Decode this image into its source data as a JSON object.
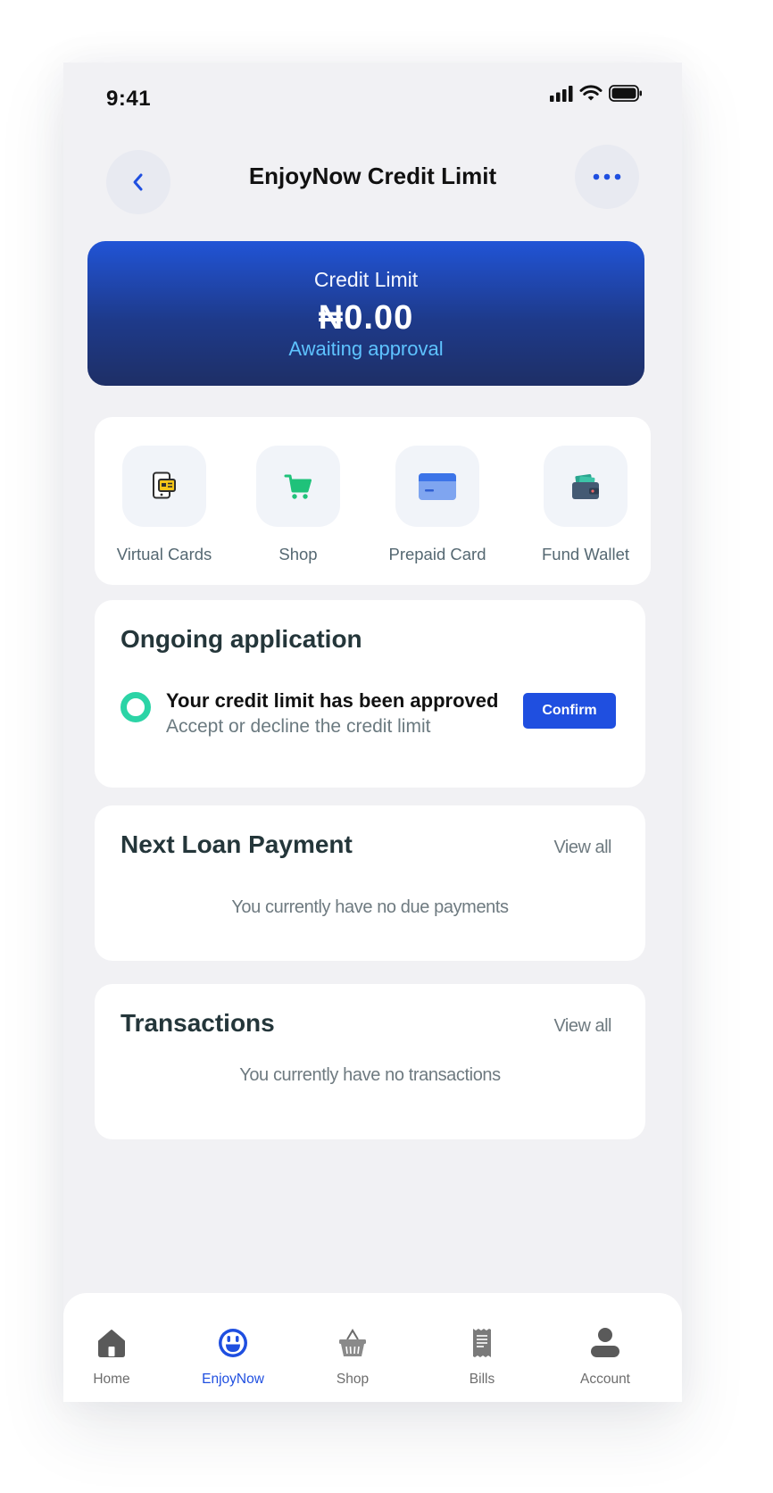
{
  "status_bar": {
    "time": "9:41"
  },
  "header": {
    "title": "EnjoyNow Credit Limit"
  },
  "credit_card": {
    "label": "Credit Limit",
    "amount": "₦0.00",
    "status": "Awaiting approval"
  },
  "quick_actions": [
    {
      "label": "Virtual Cards",
      "icon": "virtual-cards-icon"
    },
    {
      "label": "Shop",
      "icon": "cart-icon"
    },
    {
      "label": "Prepaid Card",
      "icon": "prepaid-card-icon"
    },
    {
      "label": "Fund Wallet",
      "icon": "wallet-icon"
    }
  ],
  "ongoing": {
    "title": "Ongoing application",
    "message": "Your credit limit has been approved",
    "sub": "Accept or decline the credit limit",
    "button": "Confirm"
  },
  "loan": {
    "title": "Next Loan Payment",
    "view_all": "View all",
    "empty": "You currently have no due payments"
  },
  "transactions": {
    "title": "Transactions",
    "view_all": "View all",
    "empty": "You currently have no transactions"
  },
  "bottom_nav": [
    {
      "label": "Home",
      "icon": "home-icon",
      "active": false
    },
    {
      "label": "EnjoyNow",
      "icon": "smiley-icon",
      "active": true
    },
    {
      "label": "Shop",
      "icon": "basket-icon",
      "active": false
    },
    {
      "label": "Bills",
      "icon": "receipt-icon",
      "active": false
    },
    {
      "label": "Account",
      "icon": "user-icon",
      "active": false
    }
  ],
  "colors": {
    "accent": "#1f4fe0",
    "success": "#2cd4a6",
    "card_gradient_top": "#2154d6",
    "card_gradient_bottom": "#1e2f66"
  }
}
